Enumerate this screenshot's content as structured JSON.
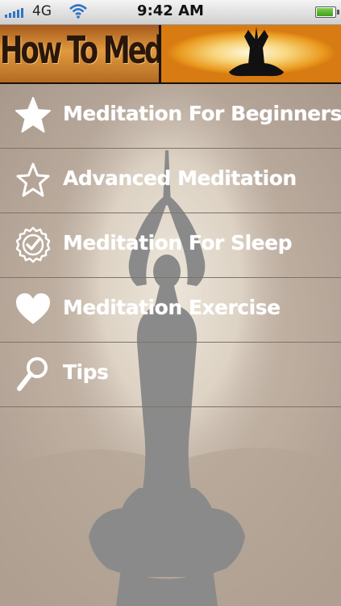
{
  "status_bar": {
    "carrier": "4G",
    "time": "9:42 AM"
  },
  "header": {
    "title": "How To Meditate"
  },
  "menu": {
    "items": [
      {
        "label": "Meditation For Beginners",
        "icon": "star-filled-icon"
      },
      {
        "label": "Advanced Meditation",
        "icon": "star-outline-icon"
      },
      {
        "label": "Meditation For Sleep",
        "icon": "badge-check-icon"
      },
      {
        "label": "Meditation Exercise",
        "icon": "heart-icon"
      },
      {
        "label": "Tips",
        "icon": "magnifier-icon"
      }
    ]
  },
  "colors": {
    "header_orange": "#e19a3e",
    "menu_background": "#b7a99b",
    "silhouette": "#8c8c8c",
    "label_text": "#ffffff"
  }
}
